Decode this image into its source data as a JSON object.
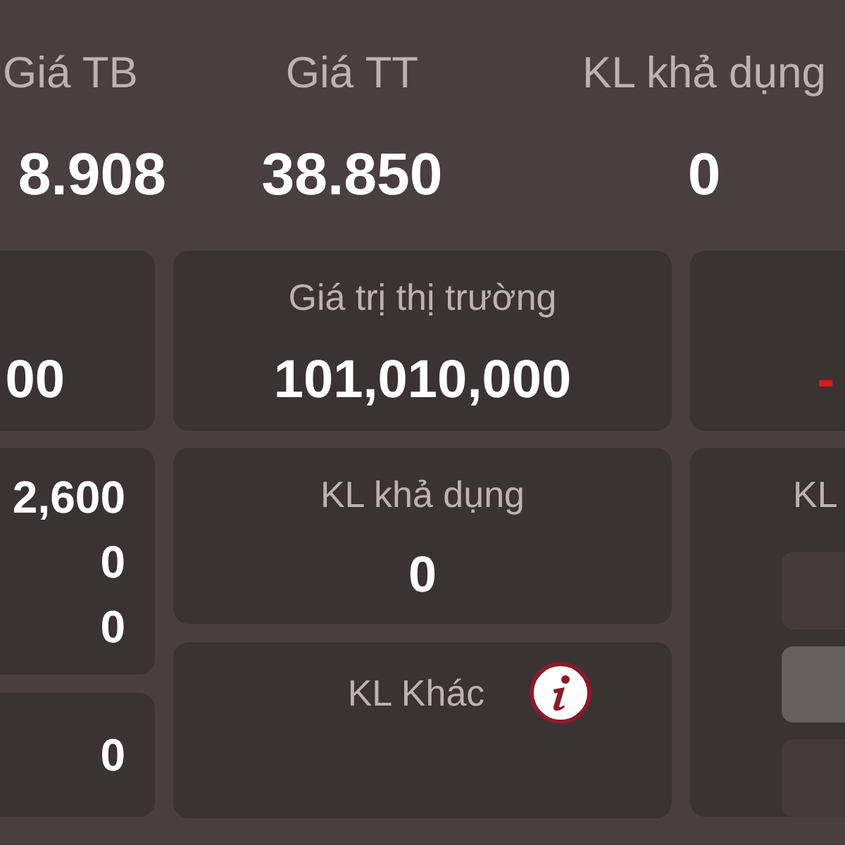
{
  "summary": [
    {
      "label": "Giá TB",
      "value": "8.908"
    },
    {
      "label": "Giá TT",
      "value": "38.850"
    },
    {
      "label": "KL khả dụng",
      "value": "0"
    }
  ],
  "value_cards": [
    {
      "value": "00"
    },
    {
      "label": "Giá trị thị trường",
      "value": "101,010,000"
    },
    {
      "value": "-",
      "color": "#e3141f"
    }
  ],
  "left_panel": {
    "values": [
      "2,600",
      "0",
      "0"
    ]
  },
  "left_bottom": {
    "value": "0"
  },
  "available_card": {
    "label": "KL khả dụng",
    "value": "0"
  },
  "other_card": {
    "label": "KL Khác"
  },
  "right_panel": {
    "heading": "KL",
    "options": [
      {
        "selected": false
      },
      {
        "selected": true
      },
      {
        "selected": false
      }
    ]
  }
}
